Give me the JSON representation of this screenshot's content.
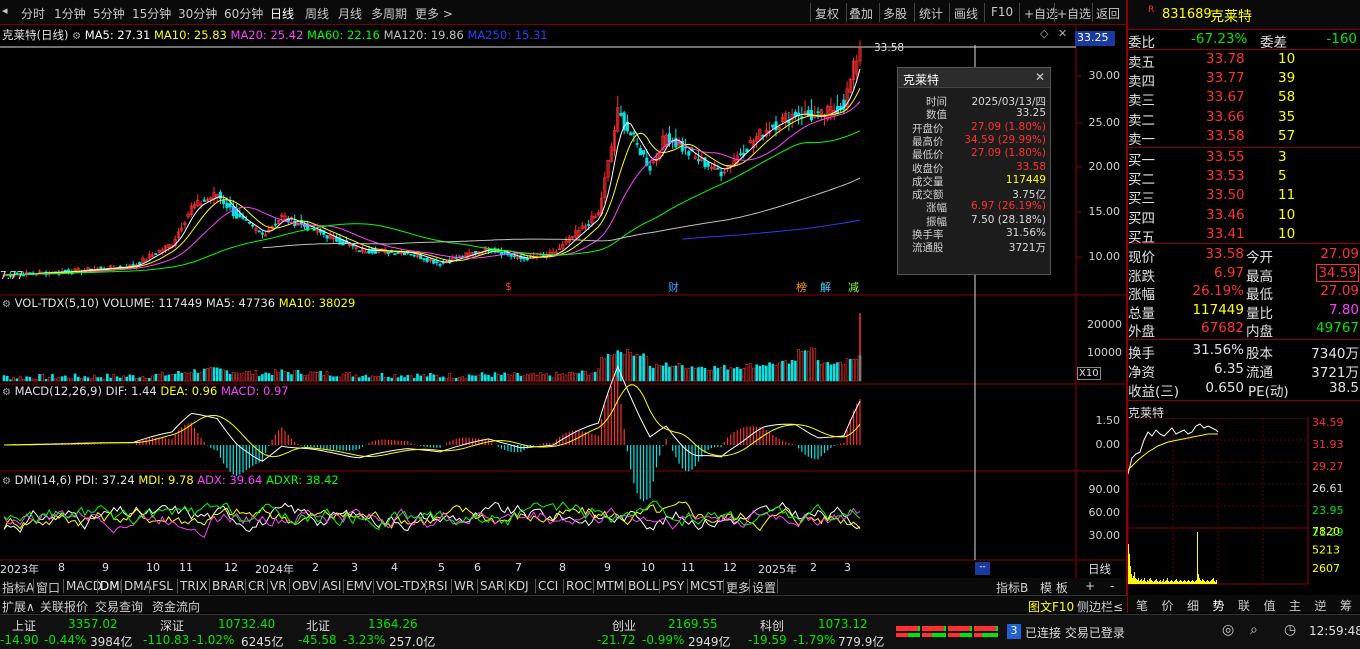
{
  "toolbar": {
    "periods": [
      "分时",
      "1分钟",
      "5分钟",
      "15分钟",
      "30分钟",
      "60分钟",
      "日线",
      "周线",
      "月线",
      "多周期",
      "更多 >"
    ],
    "active_period": "日线",
    "right_items": [
      "复权",
      "叠加",
      "多股",
      "统计",
      "画线",
      "F10",
      "+自选",
      "返回"
    ]
  },
  "main_chart": {
    "stock_name": "克莱特(日线)",
    "ma5": "MA5: 27.31",
    "ma10": "MA10: 25.83",
    "ma20": "MA20: 25.42",
    "ma60": "MA60: 22.16",
    "ma120": "MA120: 19.86",
    "ma250": "MA250: 15.31",
    "price_tag": "33.25",
    "high_label": "33.58",
    "low_label": "7.77",
    "y_ticks": [
      "30.00",
      "25.00",
      "20.00",
      "15.00",
      "10.00"
    ],
    "markers": [
      "$",
      "财",
      "榜",
      "解",
      "减"
    ]
  },
  "volume_panel": {
    "title": "VOL-TDX(5,10)",
    "volume": "VOLUME: 117449",
    "ma5": "MA5: 47736",
    "ma10": "MA10: 38029",
    "y_ticks": [
      "20000",
      "10000"
    ],
    "unit": "X10"
  },
  "macd_panel": {
    "title": "MACD(12,26,9)",
    "dif": "DIF: 1.44",
    "dea": "DEA: 0.96",
    "macd": "MACD: 0.97",
    "y_ticks": [
      "1.50",
      "0.00"
    ]
  },
  "dmi_panel": {
    "title": "DMI(14,6)",
    "pdi": "PDI: 37.24",
    "mdi": "MDI: 9.78",
    "adx": "ADX: 39.64",
    "adxr": "ADXR: 38.42",
    "y_ticks": [
      "90.00",
      "60.00",
      "30.00"
    ]
  },
  "x_axis": {
    "labels": [
      "2023年",
      "8",
      "9",
      "10",
      "11",
      "12",
      "2024年",
      "2",
      "3",
      "4",
      "5",
      "6",
      "7",
      "8",
      "9",
      "10",
      "11",
      "12",
      "2025年",
      "2",
      "3"
    ],
    "period": "日线"
  },
  "indicator_tabs": [
    "指标A",
    "窗口",
    "MACD",
    "DMI",
    "DMA",
    "FSL",
    "TRIX",
    "BRAR",
    "CR",
    "VR",
    "OBV",
    "ASI",
    "EMV",
    "VOL-TDX",
    "RSI",
    "WR",
    "SAR",
    "KDJ",
    "CCI",
    "ROC",
    "MTM",
    "BOLL",
    "PSY",
    "MCST",
    "更多",
    "设置"
  ],
  "indicator_tabs_right": [
    "指标B",
    "模 板",
    "+",
    "-"
  ],
  "tooltip": {
    "title": "克莱特",
    "rows": [
      {
        "k": "时间",
        "v": "2025/03/13/四",
        "c": "white"
      },
      {
        "k": "数值",
        "v": "33.25",
        "c": "white"
      },
      {
        "k": "开盘价",
        "v": "27.09 (1.80%)",
        "c": "red"
      },
      {
        "k": "最高价",
        "v": "34.59 (29.99%)",
        "c": "red"
      },
      {
        "k": "最低价",
        "v": "27.09 (1.80%)",
        "c": "red"
      },
      {
        "k": "收盘价",
        "v": "33.58",
        "c": "red"
      },
      {
        "k": "成交量",
        "v": "117449",
        "c": "yellow"
      },
      {
        "k": "成交额",
        "v": "3.75亿",
        "c": "white"
      },
      {
        "k": "涨幅",
        "v": "6.97 (26.19%)",
        "c": "red"
      },
      {
        "k": "振幅",
        "v": "7.50 (28.18%)",
        "c": "white"
      },
      {
        "k": "换手率",
        "v": "31.56%",
        "c": "white"
      },
      {
        "k": "流通股",
        "v": "3721万",
        "c": "white"
      }
    ]
  },
  "quote": {
    "code": "831689",
    "name": "克莱特",
    "weibi_label": "委比",
    "weibi": "-67.23%",
    "weicha_label": "委差",
    "weicha": "-160",
    "asks": [
      {
        "label": "卖五",
        "price": "33.78",
        "vol": "10"
      },
      {
        "label": "卖四",
        "price": "33.77",
        "vol": "39"
      },
      {
        "label": "卖三",
        "price": "33.67",
        "vol": "58"
      },
      {
        "label": "卖二",
        "price": "33.66",
        "vol": "35"
      },
      {
        "label": "卖一",
        "price": "33.58",
        "vol": "57"
      }
    ],
    "bids": [
      {
        "label": "买一",
        "price": "33.55",
        "vol": "3"
      },
      {
        "label": "买二",
        "price": "33.53",
        "vol": "5"
      },
      {
        "label": "买三",
        "price": "33.50",
        "vol": "11"
      },
      {
        "label": "买四",
        "price": "33.46",
        "vol": "10"
      },
      {
        "label": "买五",
        "price": "33.41",
        "vol": "10"
      }
    ],
    "stats1": [
      {
        "l1": "现价",
        "v1": "33.58",
        "c1": "red",
        "l2": "今开",
        "v2": "27.09",
        "c2": "red"
      },
      {
        "l1": "涨跌",
        "v1": "6.97",
        "c1": "red",
        "l2": "最高",
        "v2": "34.59",
        "c2": "red"
      },
      {
        "l1": "涨幅",
        "v1": "26.19%",
        "c1": "red",
        "l2": "最低",
        "v2": "27.09",
        "c2": "red"
      },
      {
        "l1": "总量",
        "v1": "117449",
        "c1": "yellow",
        "l2": "量比",
        "v2": "7.80",
        "c2": "magenta"
      },
      {
        "l1": "外盘",
        "v1": "67682",
        "c1": "red",
        "l2": "内盘",
        "v2": "49767",
        "c2": "green"
      }
    ],
    "stats2": [
      {
        "l1": "换手",
        "v1": "31.56%",
        "l2": "股本",
        "v2": "7340万"
      },
      {
        "l1": "净资",
        "v1": "6.35",
        "l2": "流通",
        "v2": "3721万"
      },
      {
        "l1": "收益(三)",
        "v1": "0.650",
        "l2": "PE(动)",
        "v2": "38.5"
      }
    ]
  },
  "mini_chart": {
    "title": "克莱特",
    "price_ticks": [
      "34.59",
      "31.93",
      "29.27",
      "26.61",
      "23.95",
      "21.29"
    ],
    "vol_ticks": [
      "7820",
      "5213",
      "2607"
    ]
  },
  "right_tabs": [
    "笔",
    "价",
    "细",
    "势",
    "联",
    "值",
    "主",
    "逆",
    "筹"
  ],
  "bottom_bar": {
    "items": [
      "扩展∧",
      "关联报价",
      "交易查询",
      "资金流向"
    ],
    "right_items": [
      "图文F10",
      "侧边栏≤"
    ]
  },
  "status_bar": {
    "indices": [
      {
        "name": "上证",
        "value": "3357.02",
        "change": "-14.90",
        "pct": "-0.44%",
        "amount": "3984亿"
      },
      {
        "name": "深证",
        "value": "10732.40",
        "change": "-110.83",
        "pct": "-1.02%",
        "amount": "6245亿"
      },
      {
        "name": "北证",
        "value": "1364.26",
        "change": "-45.58",
        "pct": "-3.23%",
        "amount": "257.0亿"
      },
      {
        "name": "创业",
        "value": "2169.55",
        "change": "-21.72",
        "pct": "-0.99%",
        "amount": "2949亿"
      },
      {
        "name": "科创",
        "value": "1073.12",
        "change": "-19.59",
        "pct": "-1.79%",
        "amount": "779.9亿"
      }
    ],
    "badge": "3",
    "connection": "已连接 交易已登录",
    "time": "12:59:48"
  },
  "colors": {
    "up": "#ff3030",
    "down": "#00e600",
    "ma5": "#ffffff",
    "ma10": "#ffff00",
    "ma20": "#ff40ff",
    "ma60": "#00ff00",
    "ma120": "#c0c0c0",
    "ma250": "#2040ff"
  }
}
